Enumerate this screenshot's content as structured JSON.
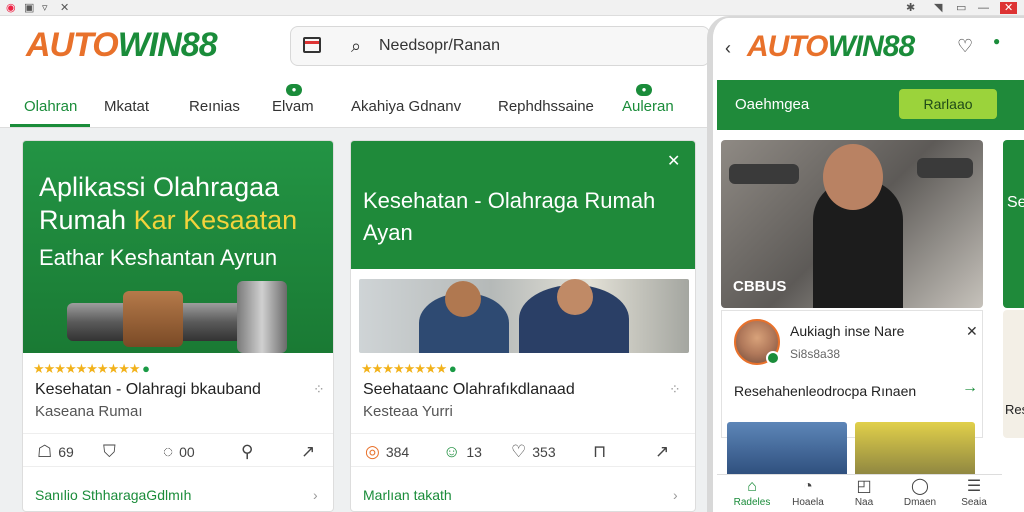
{
  "browser": {
    "icons": [
      "browser-icon",
      "tab-icon",
      "filter-icon",
      "close-icon",
      "extension-icon",
      "wifi-icon",
      "battery-icon",
      "window-close-icon"
    ]
  },
  "brand": {
    "part1": "AUTO",
    "part2": "WIN88"
  },
  "search": {
    "value": "Needsopr/​Ranan"
  },
  "tabs": [
    {
      "label": "Olahran"
    },
    {
      "label": "Mkatat"
    },
    {
      "label": "Reınias"
    },
    {
      "label": "Elvam"
    },
    {
      "label": "Akahiya Gdnanv"
    },
    {
      "label": "Rephdhssaine"
    },
    {
      "label": "Auleran"
    }
  ],
  "card1": {
    "title_line1": "Aplikassi Olahragaa",
    "title_line2_white": "Rumah",
    "title_line2_yellow": "Kar Kesaatan",
    "subtitle": "Eathar Keshantan Ayrun",
    "stars": "★★★★★★★★★★",
    "name": "Kesehatan - Olahragi bkauband",
    "sub": "Kaseana Rumaı",
    "actions": [
      {
        "icon": "calendar-icon",
        "value": "69"
      },
      {
        "icon": "shield-icon",
        "value": ""
      },
      {
        "icon": "comment-icon",
        "value": "00"
      },
      {
        "icon": "pin-icon",
        "value": ""
      },
      {
        "icon": "share-icon",
        "value": ""
      }
    ],
    "footer": "Sanılio Sthharaga​Gdlmıh"
  },
  "card2": {
    "title": "Kesehatan - Olahraga Rumah Ayan",
    "stars": "★★★★★★★★",
    "name": "Seehataanc Olahrafıkdlanaad",
    "sub": "Kesteaa Yurri",
    "actions": [
      {
        "icon": "coin-icon",
        "value": "384"
      },
      {
        "icon": "smile-icon",
        "value": "13"
      },
      {
        "icon": "heart-icon",
        "value": "353"
      },
      {
        "icon": "bookmark-icon",
        "value": ""
      },
      {
        "icon": "share-icon",
        "value": ""
      }
    ],
    "footer": "Marlıan takath"
  },
  "phone": {
    "header_text": "Oaehmgea",
    "button": "Rarlaao",
    "photo_label": "CBBUS",
    "side_label": "Seo",
    "card_title": "Aukiagh inse Nare",
    "card_sub": "Si8s8a38",
    "card_link": "Resehahenleodrocpa Rınaen",
    "side_text": "Rese",
    "nav": [
      {
        "icon": "home-icon",
        "label": "Radeles"
      },
      {
        "icon": "clock-icon",
        "label": "Hoaela"
      },
      {
        "icon": "activity-icon",
        "label": "Naa"
      },
      {
        "icon": "chat-icon",
        "label": "Dmaen"
      },
      {
        "icon": "document-icon",
        "label": "Seaia"
      }
    ]
  },
  "colors": {
    "brand_green": "#1a8c3a",
    "brand_orange": "#e8712b",
    "accent_lime": "#9bd33b",
    "star": "#f2b21b"
  }
}
